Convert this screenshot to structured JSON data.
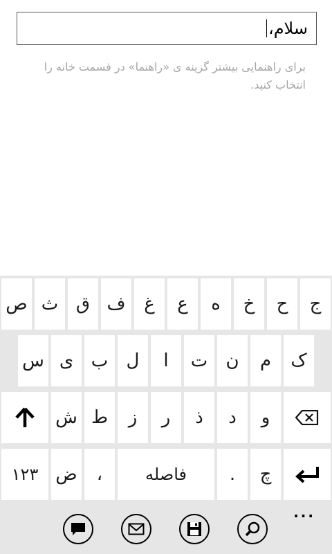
{
  "input": {
    "value": "سلام،"
  },
  "hint": {
    "text": "برای راهنمایی بیشتر گزینه ی «راهنما» در قسمت خانه را انتخاب کنید."
  },
  "keyboard": {
    "row1": [
      "ج",
      "ح",
      "خ",
      "ه",
      "ع",
      "غ",
      "ف",
      "ق",
      "ث",
      "ص"
    ],
    "row2": [
      "ک",
      "م",
      "ن",
      "ت",
      "ا",
      "ل",
      "ب",
      "ی",
      "س"
    ],
    "row3": [
      "و",
      "د",
      "ذ",
      "ر",
      "ز",
      "ط",
      "ش"
    ],
    "row4": {
      "numbers": "۱۲۳",
      "zad": "ض",
      "comma": "،",
      "space": "فاصله",
      "period": ".",
      "che": "چ"
    },
    "icons": {
      "shift": "shift-arrow-icon",
      "backspace": "backspace-icon",
      "enter": "enter-arrow-icon"
    }
  },
  "appbar": {
    "buttons": [
      "chat-bubble-icon",
      "mail-icon",
      "save-icon",
      "search-icon"
    ],
    "more": "..."
  }
}
